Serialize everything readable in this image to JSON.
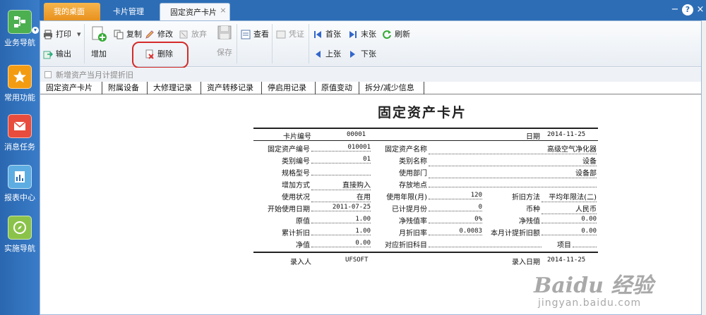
{
  "left_nav": [
    {
      "label": "业务导航",
      "icon": "business-nav-icon",
      "color": "#4caf50"
    },
    {
      "label": "常用功能",
      "icon": "star-icon",
      "color": "#f39c12"
    },
    {
      "label": "消息任务",
      "icon": "envelope-icon",
      "color": "#e74c3c"
    },
    {
      "label": "报表中心",
      "icon": "report-icon",
      "color": "#5dade2"
    },
    {
      "label": "实施导航",
      "icon": "compass-icon",
      "color": "#8bc34a"
    }
  ],
  "tabs": {
    "home": "我的桌面",
    "cards": "卡片管理",
    "active": "固定资产卡片",
    "close": "×"
  },
  "window": {
    "minimize": "−",
    "help": "?",
    "close": "×"
  },
  "toolbar": {
    "print": "打印",
    "export": "输出",
    "add": "增加",
    "copy": "复制",
    "modify": "修改",
    "abandon": "放弃",
    "delete": "删除",
    "save": "保存",
    "view": "查看",
    "voucher": "凭证",
    "first": "首张",
    "last": "末张",
    "prev": "上张",
    "next": "下张",
    "refresh": "刷新"
  },
  "checkbox_label": "新增资产当月计提折旧",
  "sub_tabs": [
    "固定资产卡片",
    "附属设备",
    "大修理记录",
    "资产转移记录",
    "停启用记录",
    "原值变动",
    "拆分/减少信息"
  ],
  "card": {
    "title": "固定资产卡片",
    "card_no_label": "卡片编号",
    "card_no": "00001",
    "date_label": "日期",
    "date": "2014-11-25",
    "rows": {
      "asset_code_label": "固定资产编号",
      "asset_code": "010001",
      "asset_name_label": "固定资产名称",
      "asset_name": "高级空气净化器",
      "category_code_label": "类别编号",
      "category_code": "01",
      "category_name_label": "类别名称",
      "category_name": "设备",
      "spec_label": "规格型号",
      "spec": "",
      "department_label": "使用部门",
      "department": "设备部",
      "add_method_label": "增加方式",
      "add_method": "直接购入",
      "location_label": "存放地点",
      "location": "",
      "status_label": "使用状况",
      "status": "在用",
      "life_label": "使用年限(月)",
      "life": "120",
      "dep_method_label": "折旧方法",
      "dep_method": "平均年限法(二)",
      "start_date_label": "开始使用日期",
      "start_date": "2011-07-25",
      "months_label": "已计提月份",
      "months": "0",
      "currency_label": "币种",
      "currency": "人民币",
      "original_label": "原值",
      "original": "1.00",
      "residual_rate_label": "净残值率",
      "residual_rate": "0%",
      "residual_label": "净残值",
      "residual": "0.00",
      "accum_label": "累计折旧",
      "accum": "1.00",
      "monthly_rate_label": "月折旧率",
      "monthly_rate": "0.0083",
      "monthly_amount_label": "本月计提折旧额",
      "monthly_amount": "0.00",
      "net_label": "净值",
      "net": "0.00",
      "account_label": "对应折旧科目",
      "account": "",
      "project_label": "项目",
      "project": ""
    },
    "recorder_label": "录入人",
    "recorder": "UFSOFT",
    "record_date_label": "录入日期",
    "record_date": "2014-11-25"
  },
  "watermark": {
    "brand": "Baidu 经验",
    "url": "jingyan.baidu.com"
  },
  "colors": {
    "highlight": "#d42a2a",
    "nav_bg": "#2d6db6",
    "home_tab": "#e8911f"
  }
}
